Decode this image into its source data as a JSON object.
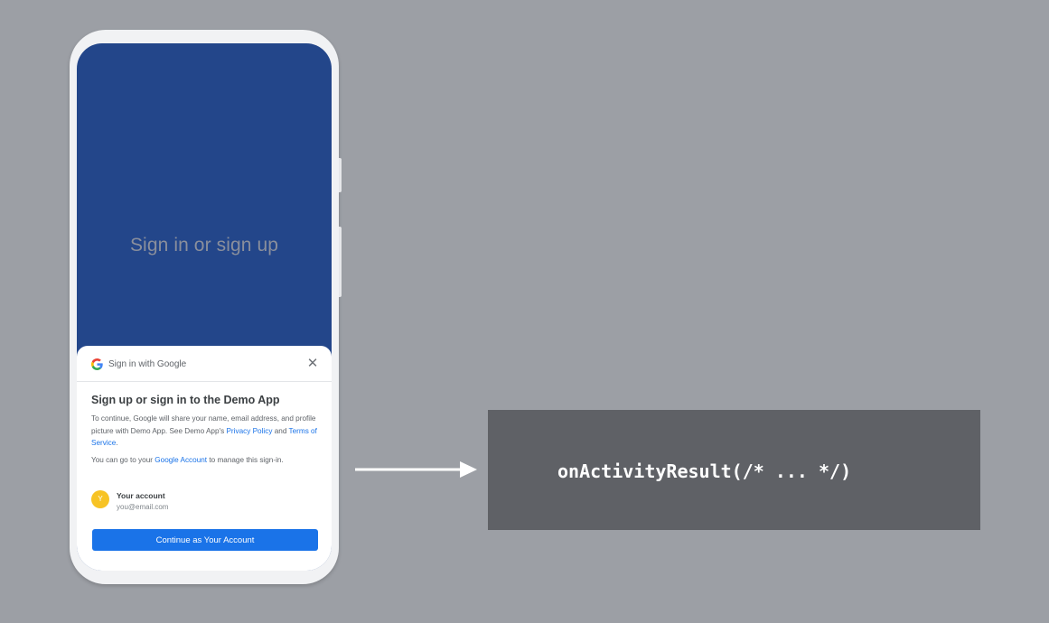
{
  "app": {
    "hero_title": "Sign in or sign up"
  },
  "sheet": {
    "header_label": "Sign in with Google",
    "title": "Sign up or sign in to the Demo App",
    "para1": {
      "text1": "To continue, Google will share your name, email address, and profile picture with Demo App. See Demo App's ",
      "link1": "Privacy Policy",
      "text2": " and ",
      "link2": "Terms of Service",
      "text3": "."
    },
    "para2": {
      "text1": "You can go to your ",
      "link": "Google Account",
      "text2": " to manage this sign-in."
    },
    "account": {
      "avatar_initial": "Y",
      "label": "Your account",
      "email": "you@email.com"
    },
    "continue_label": "Continue as Your Account"
  },
  "code": {
    "text": "onActivityResult(/* ... */)"
  },
  "icons": {
    "logo": "google-g-icon",
    "close": "close-icon",
    "arrow": "arrow-right-icon"
  },
  "colors": {
    "background": "#9c9fa5",
    "app_blue": "#23468a",
    "primary_button": "#1a73e8",
    "code_panel": "#5f6166",
    "avatar": "#f7c325"
  }
}
